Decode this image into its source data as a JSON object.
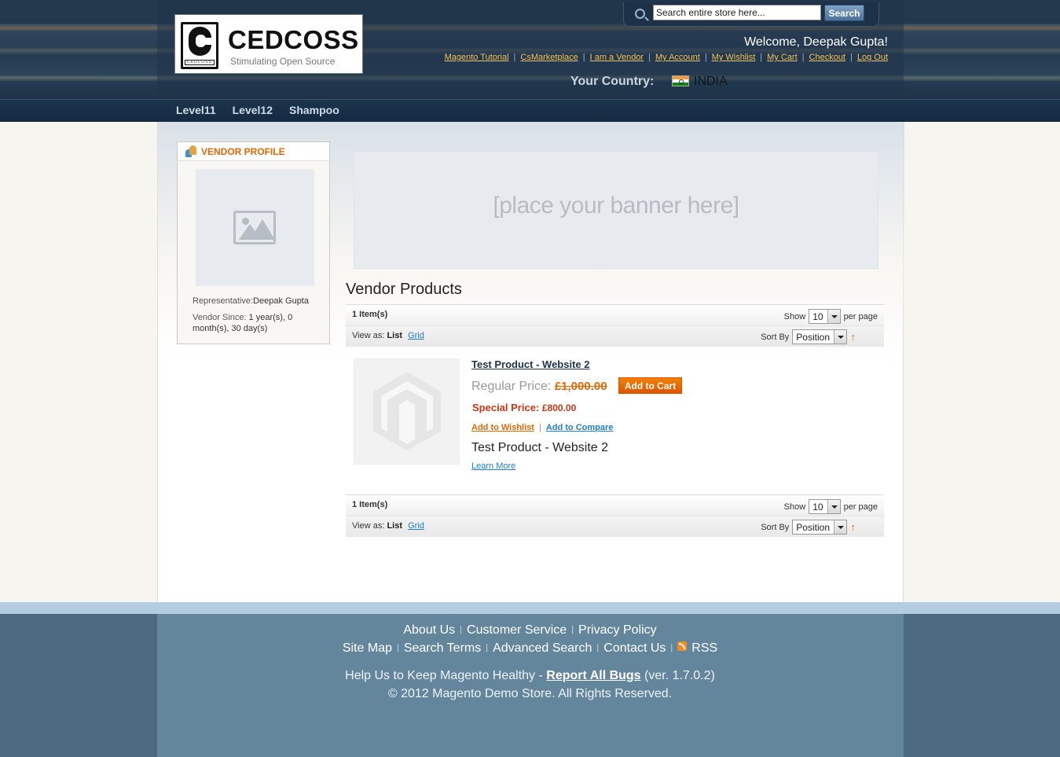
{
  "header": {
    "logo_title": "CEDCOSS",
    "logo_tagline": "Stimulating Open Source",
    "logo_small": "CEDCOSS",
    "search": {
      "placeholder": "Search entire store here...",
      "value": "Search entire store here...",
      "button_label": "Search"
    },
    "welcome": "Welcome, Deepak Gupta!",
    "links": [
      "Magento Tutorial",
      "CsMarketplace",
      "I am a Vendor",
      "My Account",
      "My Wishlist",
      "My Cart",
      "Checkout",
      "Log Out"
    ],
    "country_label": "Your Country:",
    "country_name": "INDIA"
  },
  "nav": {
    "items": [
      "Level11",
      "Level12",
      "Shampoo"
    ]
  },
  "vendor": {
    "title": "VENDOR PROFILE",
    "rep_label": "Representative:",
    "rep_value": "Deepak Gupta",
    "since_label": "Vendor Since:",
    "since_value": " 1 year(s), 0 month(s), 30 day(s)"
  },
  "banner": {
    "text": "[place your banner here]"
  },
  "products": {
    "title": "Vendor Products",
    "toolbar": {
      "items_count": "1 Item(s)",
      "show_label": "Show",
      "limit": "10",
      "per_page": "per page",
      "view_label": "View as:",
      "view_current": "List",
      "view_grid": "Grid",
      "sort_label": "Sort By",
      "sort_value": "Position",
      "sort_arrow": "↑"
    },
    "items": [
      {
        "name": "Test Product - Website 2",
        "regular_label": "Regular Price:",
        "regular_value": "£1,000.00",
        "special_label": "Special Price:",
        "special_value": "£800.00",
        "add_to_cart": "Add to Cart",
        "add_wishlist": "Add to Wishlist",
        "add_compare": "Add to Compare",
        "short_desc": "Test Product - Website 2",
        "learn_more": "Learn More"
      }
    ]
  },
  "footer": {
    "row1": [
      "About Us",
      "Customer Service",
      "Privacy Policy"
    ],
    "row2": [
      "Site Map",
      "Search Terms",
      "Advanced Search",
      "Contact Us",
      "RSS"
    ],
    "help_prefix": "Help Us to Keep Magento Healthy - ",
    "help_link": "Report All Bugs",
    "help_suffix": " (ver. 1.7.0.2)",
    "copyright": "© 2012 Magento Demo Store. All Rights Reserved."
  },
  "colors": {
    "accent_orange": "#e26703",
    "link_blue": "#1e7ec8",
    "header_navy": "#1d344d",
    "footer_blue": "#64869d",
    "link_gold": "#f2c25c"
  }
}
